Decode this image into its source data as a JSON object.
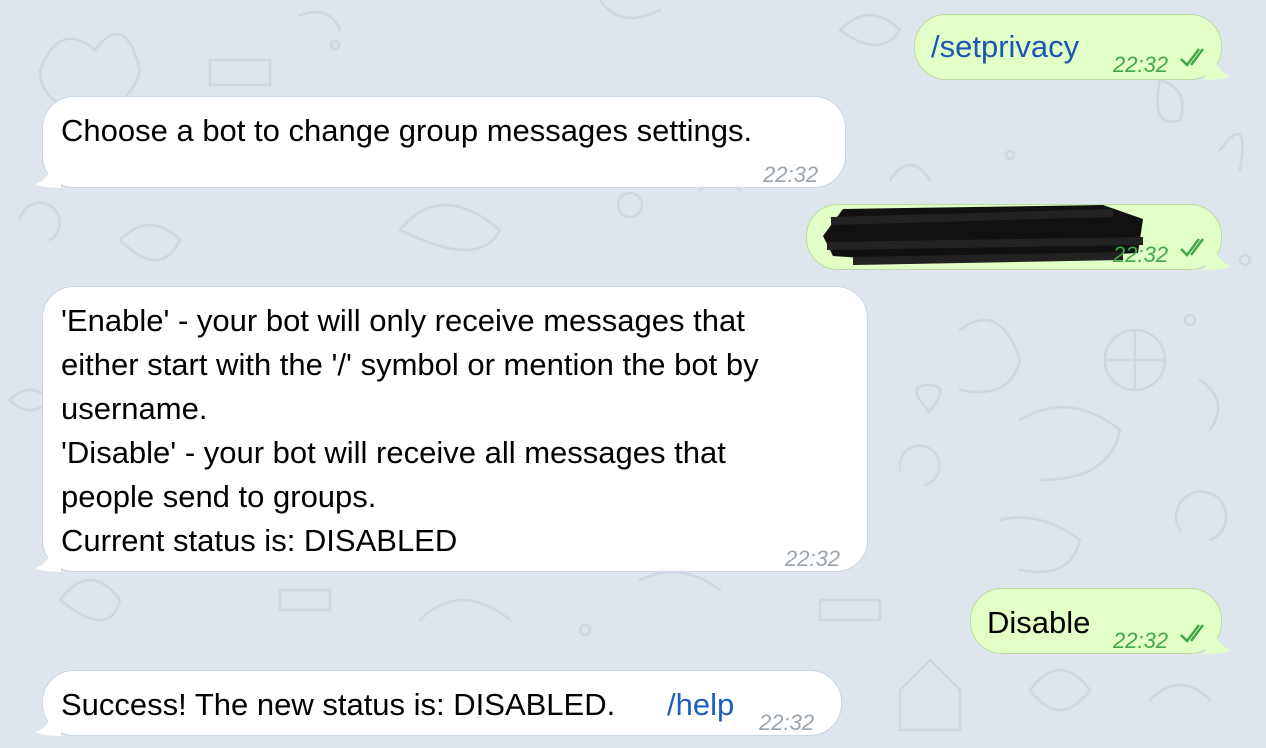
{
  "colors": {
    "background": "#dfe5ec",
    "incoming_bubble": "#ffffff",
    "outgoing_bubble": "#e1ffc7",
    "outgoing_time": "#3fa845",
    "incoming_time": "#9aa4ad",
    "link": "#1c5fc0"
  },
  "messages": [
    {
      "direction": "outgoing",
      "text": "/setprivacy",
      "time": "22:32",
      "status_icon": "double-check-icon"
    },
    {
      "direction": "incoming",
      "text": "Choose a bot to change group messages settings.",
      "time": "22:32"
    },
    {
      "direction": "outgoing",
      "redacted": true,
      "time": "22:32",
      "status_icon": "double-check-icon"
    },
    {
      "direction": "incoming",
      "lines": [
        "'Enable' - your bot will only receive messages that",
        "either start with the '/' symbol or mention the bot by",
        "username.",
        "'Disable' - your bot will receive all messages that",
        "people send to groups.",
        "Current status is: DISABLED"
      ],
      "time": "22:32"
    },
    {
      "direction": "outgoing",
      "text": "Disable",
      "time": "22:32",
      "status_icon": "double-check-icon"
    },
    {
      "direction": "incoming",
      "text": "Success! The new status is: DISABLED.",
      "link": "/help",
      "time": "22:32"
    }
  ]
}
